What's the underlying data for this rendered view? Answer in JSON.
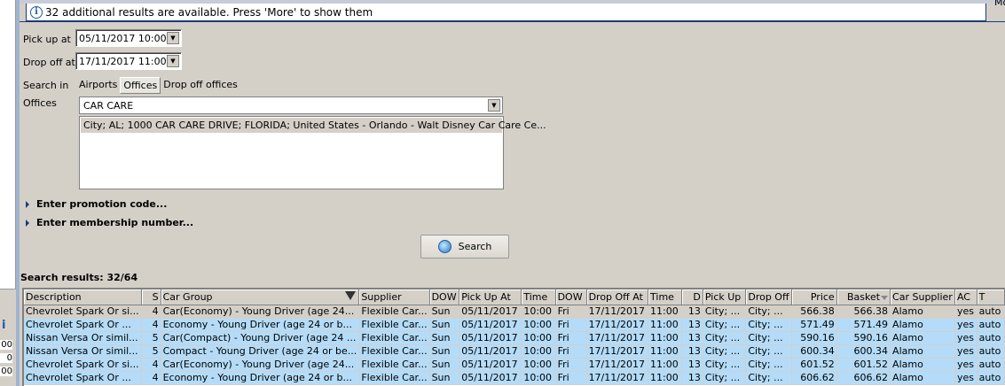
{
  "info_message": "32 additional results are available. Press 'More' to show them",
  "top_right_fragment": "Mo",
  "left_panel": {
    "values": [
      "00",
      "0",
      "00"
    ]
  },
  "form": {
    "pickup_label": "Pick up at",
    "pickup_value": "05/11/2017 10:00",
    "dropoff_label": "Drop off at",
    "dropoff_value": "17/11/2017 11:00",
    "search_in_label": "Search in",
    "search_in_tabs": [
      "Airports",
      "Offices",
      "Drop off offices"
    ],
    "offices_label": "Offices",
    "offices_value": "CAR CARE",
    "office_results": [
      "City; AL; 1000 CAR CARE DRIVE; FLORIDA; United States - Orlando - Walt Disney Car Care Ce..."
    ],
    "promotion": "Enter promotion code...",
    "membership": "Enter membership number...",
    "search_button": "Search"
  },
  "results_label": "Search results: 32/64",
  "table": {
    "columns": [
      "Description",
      "S",
      "Car Group",
      "Supplier",
      "DOW",
      "Pick Up At",
      "Time",
      "DOW",
      "Drop Off At",
      "Time",
      "D",
      "Pick Up",
      "Drop Off",
      "Price",
      "Basket",
      "Car Supplier",
      "AC",
      "T"
    ],
    "rows": [
      [
        "Chevrolet Spark Or si...",
        "4",
        "Car(Economy) - Young Driver (age 24...",
        "Flexible Car...",
        "Sun",
        "05/11/2017",
        "10:00",
        "Fri",
        "17/11/2017",
        "11:00",
        "13",
        "City; ...",
        "City; ...",
        "566.38",
        "566.38",
        "Alamo",
        "yes",
        "auto"
      ],
      [
        "Chevrolet  Spark Or ...",
        "4",
        "Economy - Young Driver (age 24 or b...",
        "Flexible Car...",
        "Sun",
        "05/11/2017",
        "10:00",
        "Fri",
        "17/11/2017",
        "11:00",
        "13",
        "City; ...",
        "City; ...",
        "571.49",
        "571.49",
        "Alamo",
        "yes",
        "auto"
      ],
      [
        "Nissan Versa Or simil...",
        "5",
        "Car(Compact) - Young Driver (age 24 ...",
        "Flexible Car...",
        "Sun",
        "05/11/2017",
        "10:00",
        "Fri",
        "17/11/2017",
        "11:00",
        "13",
        "City; ...",
        "City; ...",
        "590.16",
        "590.16",
        "Alamo",
        "yes",
        "auto"
      ],
      [
        "Nissan Versa Or simil...",
        "5",
        "Compact - Young Driver (age 24 or be...",
        "Flexible Car...",
        "Sun",
        "05/11/2017",
        "10:00",
        "Fri",
        "17/11/2017",
        "11:00",
        "13",
        "City; ...",
        "City; ...",
        "600.34",
        "600.34",
        "Alamo",
        "yes",
        "auto"
      ],
      [
        "Chevrolet Spark Or si...",
        "4",
        "Car(Economy) - Young Driver (age 24...",
        "Flexible Car...",
        "Sun",
        "05/11/2017",
        "10:00",
        "Fri",
        "17/11/2017",
        "11:00",
        "13",
        "City; ...",
        "City; ...",
        "601.52",
        "601.52",
        "Alamo",
        "yes",
        "auto"
      ],
      [
        "Chevrolet  Spark Or ...",
        "4",
        "Economy - Young Driver (age 24 or b...",
        "Flexible Car...",
        "Sun",
        "05/11/2017",
        "10:00",
        "Fri",
        "17/11/2017",
        "11:00",
        "13",
        "City; ...",
        "City; ...",
        "606.62",
        "606.62",
        "Alamo",
        "yes",
        "auto"
      ]
    ]
  },
  "colors": {
    "selected_row": "#b4dcf8",
    "current_row": "#d4d0c8",
    "window_bg": "#d4d0c8"
  }
}
